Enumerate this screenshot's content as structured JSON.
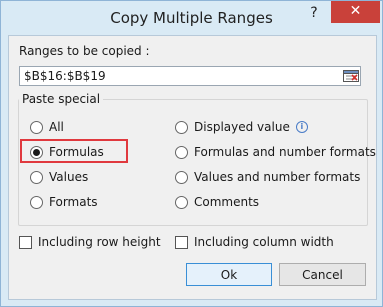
{
  "window": {
    "title": "Copy Multiple Ranges",
    "help": "?",
    "close": "✕"
  },
  "ranges": {
    "label": "Ranges to be copied :",
    "value": "$B$16:$B$19"
  },
  "paste_special": {
    "title": "Paste special",
    "left_options": [
      "All",
      "Formulas",
      "Values",
      "Formats"
    ],
    "right_options": [
      "Displayed value",
      "Formulas and number formats",
      "Values and number formats",
      "Comments"
    ],
    "selected": "Formulas"
  },
  "info_icon": "i",
  "checkboxes": {
    "row_height": "Including row height",
    "column_width": "Including column width"
  },
  "buttons": {
    "ok": "Ok",
    "cancel": "Cancel"
  }
}
